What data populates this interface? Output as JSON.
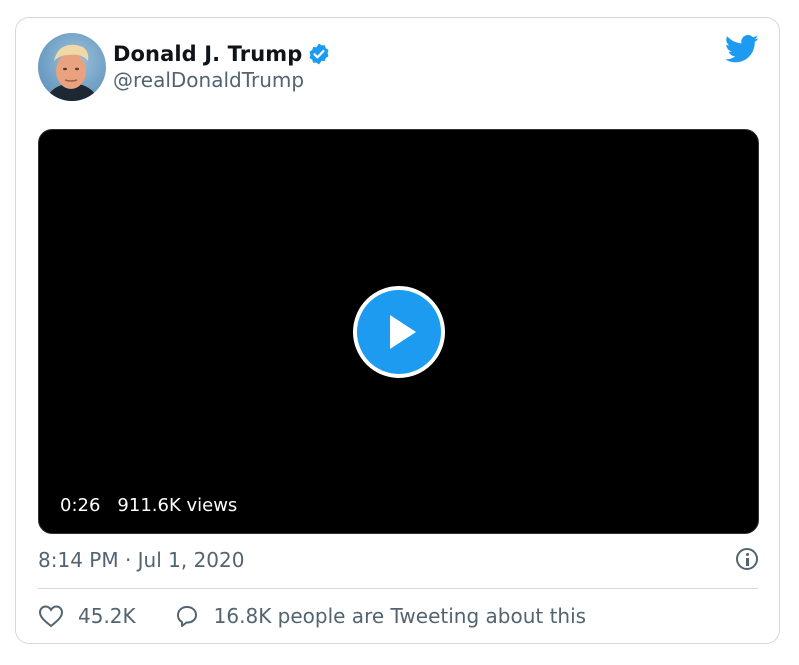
{
  "tweet": {
    "author_name": "Donald J. Trump",
    "handle": "@realDonaldTrump",
    "timestamp": "8:14 PM · Jul 1, 2020",
    "video": {
      "duration": "0:26",
      "views": "911.6K views"
    },
    "likes": "45.2K",
    "tweeting": "16.8K people are Tweeting about this"
  },
  "icons": {
    "verified": "verified-badge-icon",
    "brand": "twitter-bird-icon",
    "play": "play-icon",
    "info": "info-icon",
    "like": "heart-icon",
    "reply": "speech-bubble-icon"
  },
  "colors": {
    "accent": "#1d9bf0",
    "text_primary": "#0f1419",
    "text_secondary": "#536471",
    "border": "#cfd9de",
    "video_bg": "#000000"
  }
}
